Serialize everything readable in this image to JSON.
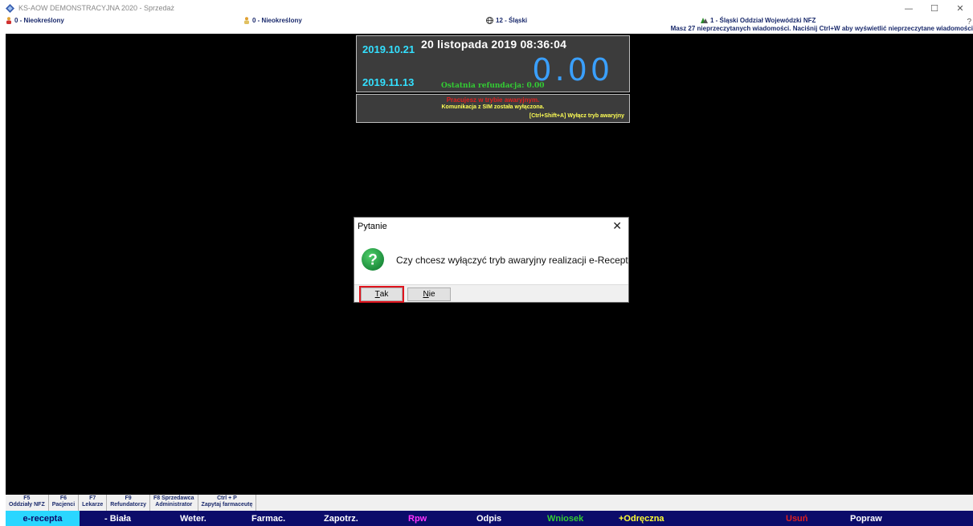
{
  "window": {
    "title": "KS-AOW DEMONSTRACYJNA 2020 - Sprzedaż",
    "minimize_glyph": "—",
    "maximize_glyph": "☐",
    "close_glyph": "✕"
  },
  "infobar": {
    "user_left": "0 - Nieokreślony",
    "user_mid": "0 - Nieokreślony",
    "region": "12 - Śląski",
    "nfz_branch": "1 - Śląski Oddział Wojewódzki NFZ",
    "messages_notice": "Masz 27 nieprzeczytanych wiadomości. Naciśnij Ctrl+W aby wyświetlić nieprzeczytane wiadomości",
    "help_glyph": "?"
  },
  "register": {
    "date_top": "2019.10.21",
    "date_bottom": "2019.11.13",
    "datetime": "20 listopada 2019  08:36:04",
    "amount": "0.00",
    "last_refund": "Ostatnia refundacja: 0.00"
  },
  "emergency": {
    "mode_text": "Pracujesz w trybie awaryjnym.",
    "sim_text": "Komunikacja z SIM została wyłączona.",
    "shortcut_text": "[Ctrl+Shift+A] Wyłącz tryb awaryjny"
  },
  "dialog": {
    "title": "Pytanie",
    "close_glyph": "✕",
    "message": "Czy chcesz wyłączyć tryb awaryjny realizacji e-Recept",
    "yes_label": "Tak",
    "no_label": "Nie"
  },
  "function_keys": [
    {
      "key": "F5",
      "label": "Oddziały NFZ"
    },
    {
      "key": "F6",
      "label": "Pacjenci"
    },
    {
      "key": "F7",
      "label": "Lekarze"
    },
    {
      "key": "F9",
      "label": "Refundatorzy"
    },
    {
      "key": "F8 Sprzedawca",
      "label": "Administrator"
    },
    {
      "key": "Ctrl + P",
      "label": "Zapytaj farmaceutę"
    }
  ],
  "sale_types": [
    {
      "label": "e-recepta",
      "color": "#0c0c6a",
      "active": true
    },
    {
      "label": "- Biała",
      "color": "#ffffff"
    },
    {
      "label": "Weter.",
      "color": "#ffffff"
    },
    {
      "label": "Farmac.",
      "color": "#ffffff"
    },
    {
      "label": "Zapotrz.",
      "color": "#ffffff"
    },
    {
      "label": "Rpw",
      "color": "#ff33ff"
    },
    {
      "label": "Odpis",
      "color": "#ffffff"
    },
    {
      "label": "Wniosek",
      "color": "#33cc33"
    },
    {
      "label": "+Odręczna",
      "color": "#ffff33"
    },
    {
      "label": "Usuń",
      "color": "#e02020"
    },
    {
      "label": "Popraw",
      "color": "#ffffff"
    }
  ],
  "colors": {
    "background": "#000000",
    "display_panel": "#3c3c3c",
    "typebar": "#0c0c6a",
    "active_tab": "#2ad6ff",
    "yes_highlight": "#e0141e"
  }
}
